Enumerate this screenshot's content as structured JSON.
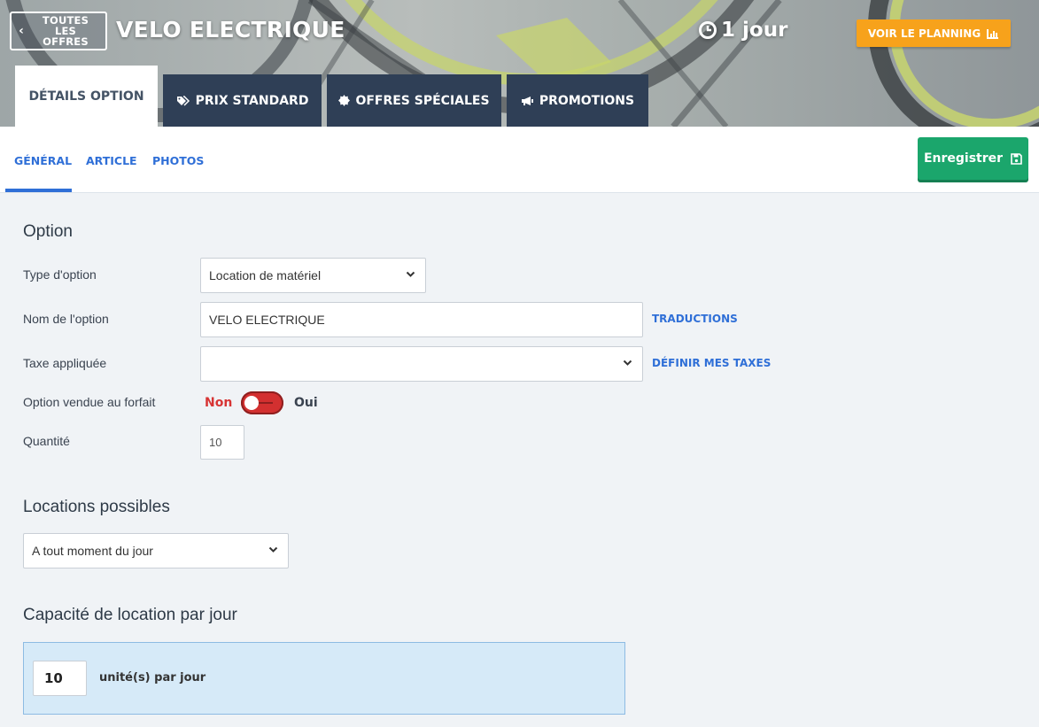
{
  "header": {
    "back_label": "TOUTES LES OFFRES",
    "title": "VELO ELECTRIQUE",
    "duration": "1 jour",
    "planning_label": "VOIR LE PLANNING"
  },
  "tabs": [
    {
      "label": "DÉTAILS OPTION",
      "icon": "none",
      "active": true
    },
    {
      "label": "PRIX STANDARD",
      "icon": "tags-icon",
      "active": false
    },
    {
      "label": "OFFRES SPÉCIALES",
      "icon": "certificate-icon",
      "active": false
    },
    {
      "label": "PROMOTIONS",
      "icon": "bullhorn-icon",
      "active": false
    }
  ],
  "subnav": {
    "items": [
      {
        "label": "GÉNÉRAL",
        "active": true
      },
      {
        "label": "ARTICLE",
        "active": false
      },
      {
        "label": "PHOTOS",
        "active": false
      }
    ],
    "save_label": "Enregistrer"
  },
  "option": {
    "section_title": "Option",
    "type_label": "Type d'option",
    "type_value": "Location de matériel",
    "name_label": "Nom de l'option",
    "name_value": "VELO ELECTRIQUE",
    "translations_link": "TRADUCTIONS",
    "tax_label": "Taxe appliquée",
    "tax_value": "",
    "define_taxes_link": "DÉFINIR MES TAXES",
    "package_label": "Option vendue au forfait",
    "toggle_off_label": "Non",
    "toggle_on_label": "Oui",
    "toggle_state": "Non",
    "quantity_label": "Quantité",
    "quantity_value": "10"
  },
  "locations": {
    "section_title": "Locations possibles",
    "value": "A tout moment du jour"
  },
  "capacity": {
    "section_title": "Capacité de location par jour",
    "value": "10",
    "unit_label": "unité(s) par jour"
  },
  "colors": {
    "tab_bg": "#2f3f56",
    "accent_blue": "#2f6fd7",
    "save_green": "#1ba66c",
    "planning_orange": "#f7a21b",
    "toggle_red": "#d33030",
    "capacity_bg": "#d6eaf8"
  }
}
